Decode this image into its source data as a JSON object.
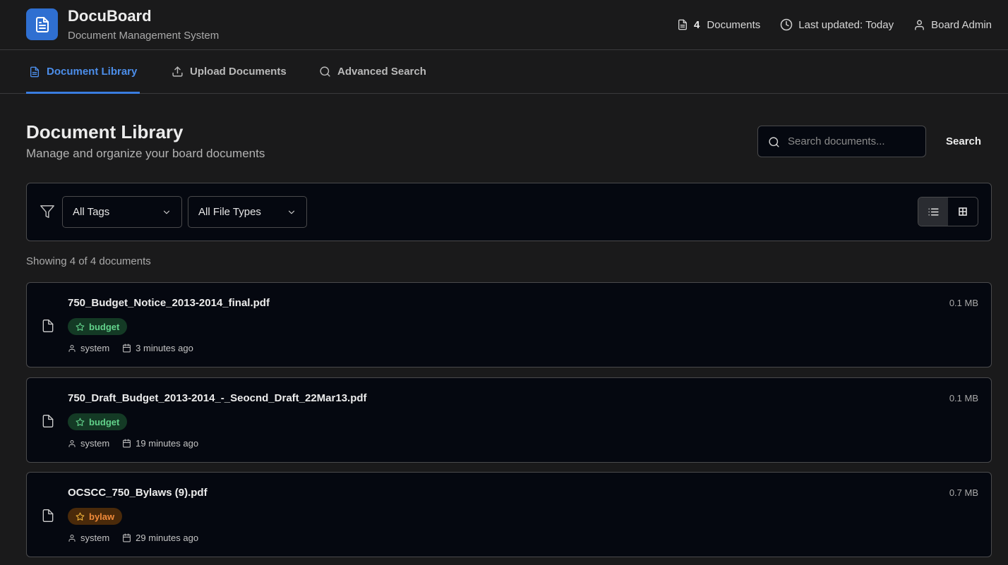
{
  "app": {
    "title": "DocuBoard",
    "subtitle": "Document Management System"
  },
  "header": {
    "doc_count": "4",
    "doc_count_label": "Documents",
    "last_updated": "Last updated: Today",
    "user": "Board Admin"
  },
  "tabs": [
    {
      "label": "Document Library",
      "active": true,
      "icon": "file-text-icon"
    },
    {
      "label": "Upload Documents",
      "active": false,
      "icon": "upload-icon"
    },
    {
      "label": "Advanced Search",
      "active": false,
      "icon": "search-icon"
    }
  ],
  "page": {
    "title": "Document Library",
    "subtitle": "Manage and organize your board documents"
  },
  "search": {
    "placeholder": "Search documents...",
    "value": "",
    "button_label": "Search"
  },
  "filters": {
    "tags_selected": "All Tags",
    "file_types_selected": "All File Types",
    "view_mode": "list"
  },
  "showing_text": "Showing 4 of 4 documents",
  "documents": [
    {
      "name": "750_Budget_Notice_2013-2014_final.pdf",
      "size": "0.1 MB",
      "tag": "budget",
      "owner": "system",
      "time": "3 minutes ago"
    },
    {
      "name": "750_Draft_Budget_2013-2014_-_Seocnd_Draft_22Mar13.pdf",
      "size": "0.1 MB",
      "tag": "budget",
      "owner": "system",
      "time": "19 minutes ago"
    },
    {
      "name": "OCSCC_750_Bylaws (9).pdf",
      "size": "0.7 MB",
      "tag": "bylaw",
      "owner": "system",
      "time": "29 minutes ago"
    }
  ],
  "colors": {
    "accent": "#3a7de0",
    "budget_tag_bg": "#143a25",
    "budget_tag_text": "#62d28b",
    "bylaw_tag_bg": "#4a2a0a",
    "bylaw_tag_text": "#f08a3a"
  }
}
